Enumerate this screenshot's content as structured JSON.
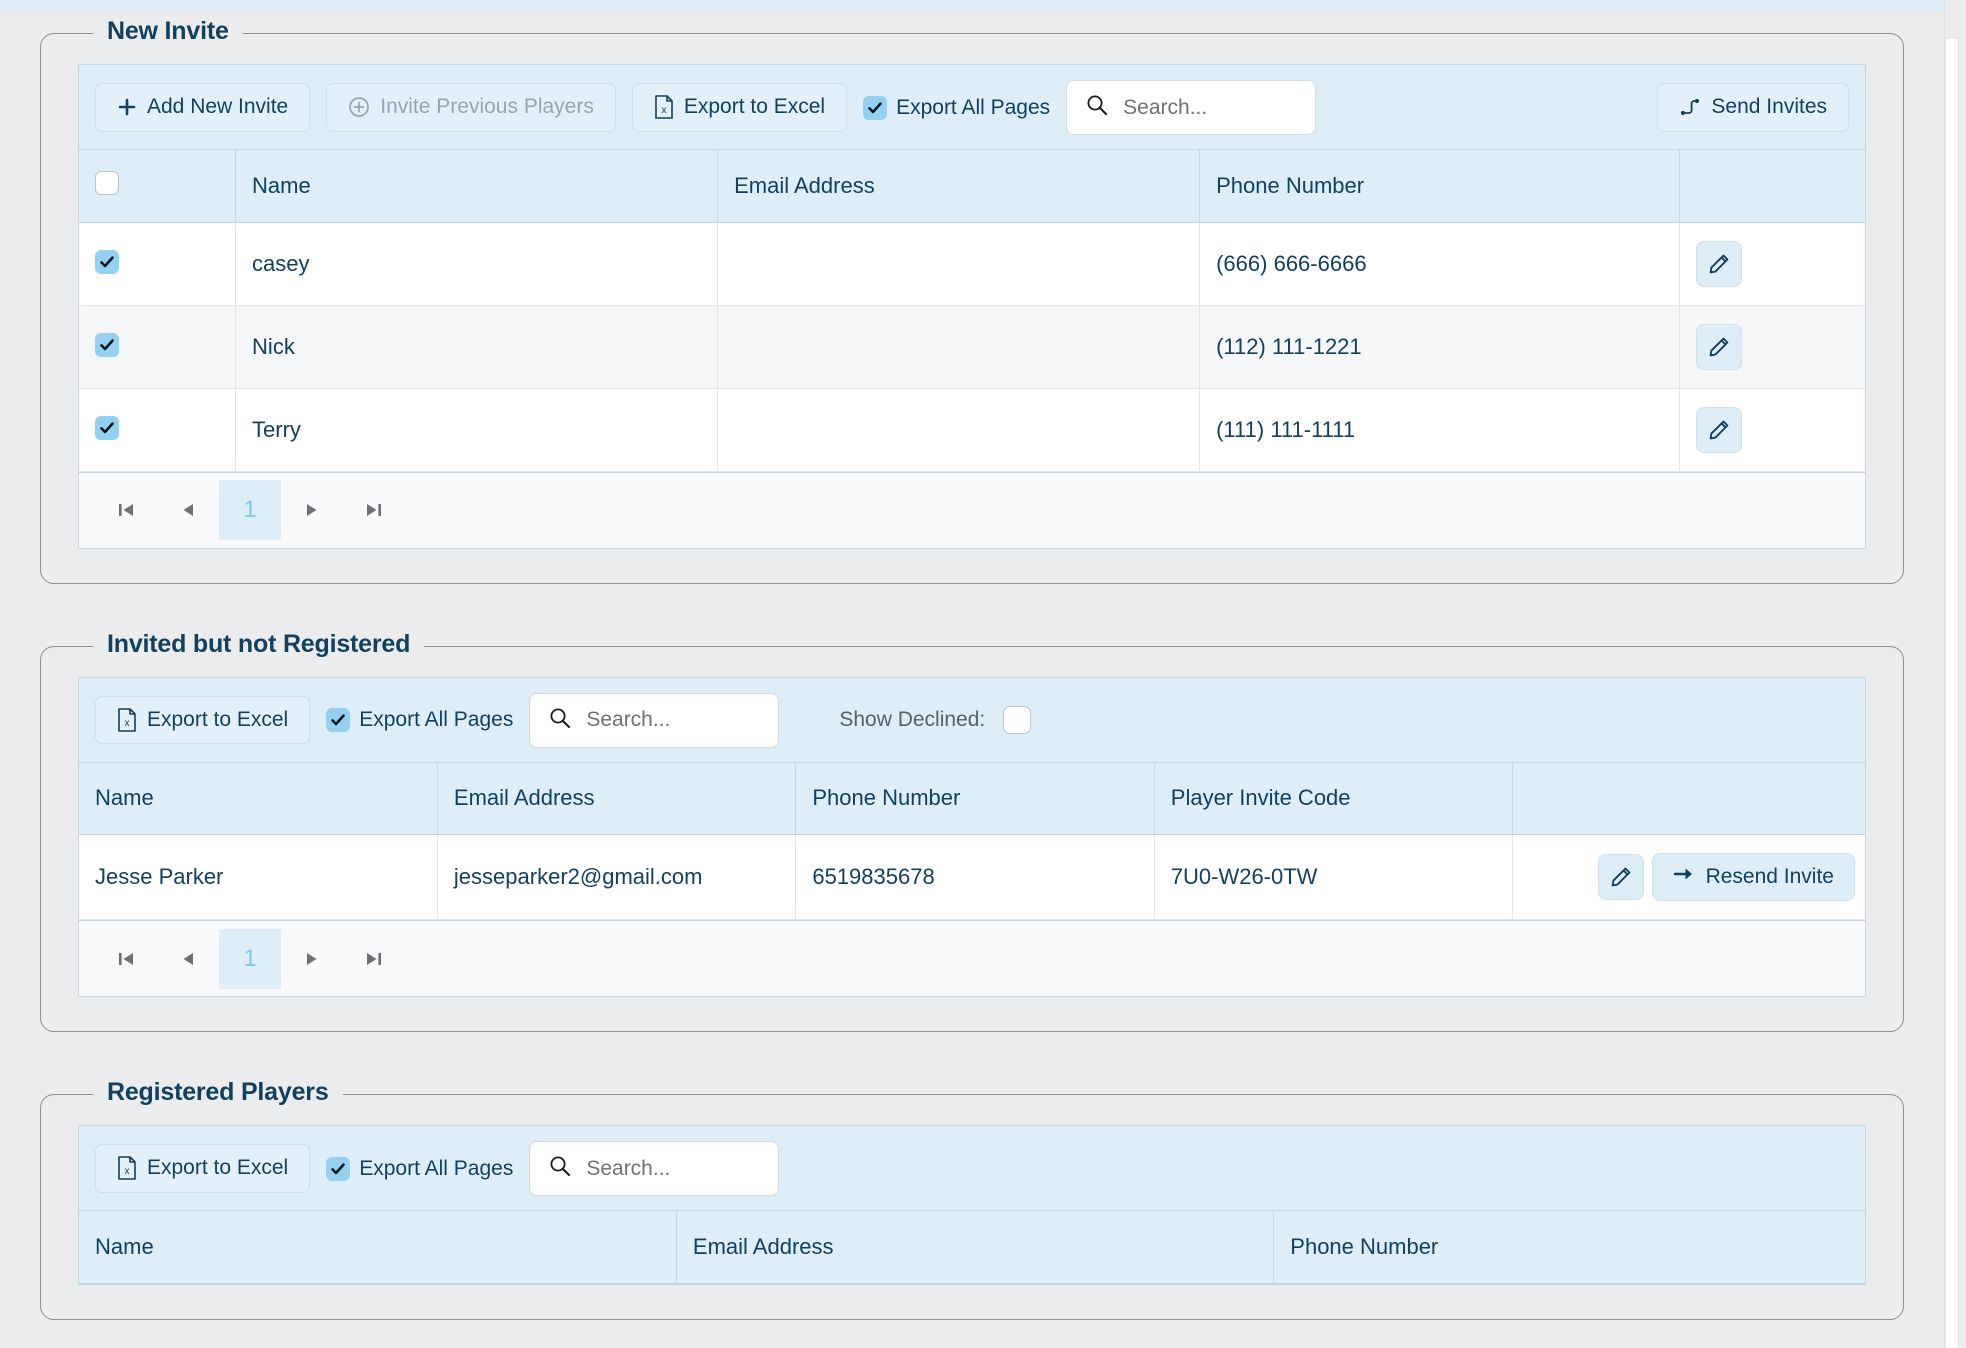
{
  "sections": [
    {
      "title": "New Invite",
      "toolbar": {
        "add_new_invite": "Add New Invite",
        "invite_previous_players": "Invite Previous Players",
        "export_to_excel": "Export to Excel",
        "export_all_pages": "Export All Pages",
        "export_all_pages_checked": true,
        "search_placeholder": "Search...",
        "search_value": "",
        "send_invites": "Send Invites"
      },
      "columns": [
        "",
        "Name",
        "Email Address",
        "Phone Number",
        ""
      ],
      "rows": [
        {
          "selected": true,
          "name": "casey",
          "email": "",
          "phone": "(666) 666-6666"
        },
        {
          "selected": true,
          "name": "Nick",
          "email": "",
          "phone": "(112) 111-1221"
        },
        {
          "selected": true,
          "name": "Terry",
          "email": "",
          "phone": "(111) 111-1111"
        }
      ],
      "header_select_all_checked": false,
      "pager": {
        "first": "|<",
        "prev": "<",
        "page": "1",
        "next": ">",
        "last": ">|"
      }
    },
    {
      "title": "Invited but not Registered",
      "toolbar": {
        "export_to_excel": "Export to Excel",
        "export_all_pages": "Export All Pages",
        "export_all_pages_checked": true,
        "search_placeholder": "Search...",
        "search_value": "",
        "show_declined_label": "Show Declined:",
        "show_declined_checked": false
      },
      "columns": [
        "Name",
        "Email Address",
        "Phone Number",
        "Player Invite Code",
        ""
      ],
      "rows": [
        {
          "name": "Jesse Parker",
          "email": "jesseparker2@gmail.com",
          "phone": "6519835678",
          "invite_code": "7U0-W26-0TW",
          "resend_label": "Resend Invite"
        }
      ],
      "pager": {
        "first": "|<",
        "prev": "<",
        "page": "1",
        "next": ">",
        "last": ">|"
      }
    },
    {
      "title": "Registered Players",
      "toolbar": {
        "export_to_excel": "Export to Excel",
        "export_all_pages": "Export All Pages",
        "export_all_pages_checked": true,
        "search_placeholder": "Search...",
        "search_value": ""
      },
      "columns": [
        "Name",
        "Email Address",
        "Phone Number"
      ],
      "rows": []
    }
  ],
  "icons": {
    "plus": "plus-icon",
    "circle_plus": "circle-plus-icon",
    "excel": "excel-file-icon",
    "search": "search-icon",
    "send": "send-route-icon",
    "pencil": "pencil-icon",
    "arrow_right": "arrow-right-icon"
  },
  "colors": {
    "accent": "#93d0f2",
    "header_bg": "#ddeef8",
    "title_text": "#12405f",
    "page_bg": "#eaecee",
    "border": "#8a8f94"
  }
}
